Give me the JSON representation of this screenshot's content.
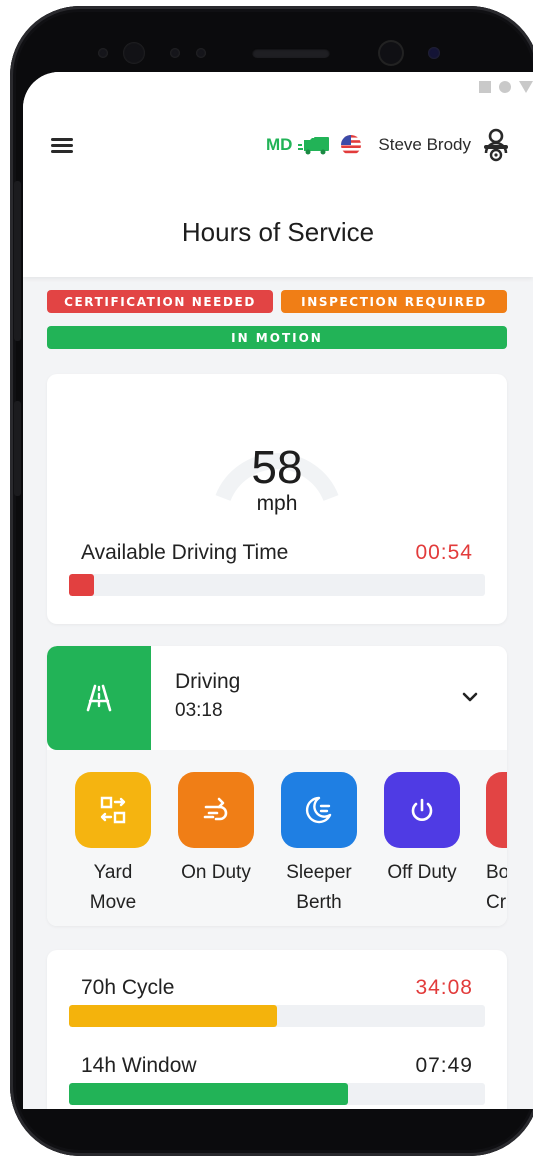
{
  "header": {
    "state_code": "MD",
    "driver_name": "Steve Brody",
    "title": "Hours of Service"
  },
  "badges": {
    "certification": "CERTIFICATION NEEDED",
    "inspection": "INSPECTION REQUIRED",
    "motion": "IN MOTION"
  },
  "speed": {
    "value": "58",
    "unit": "mph"
  },
  "available_driving": {
    "label": "Available Driving Time",
    "value": "00:54",
    "progress": 0.06
  },
  "duty_status": {
    "current": "Driving",
    "elapsed": "03:18",
    "options": [
      {
        "label": "Yard\nMove",
        "icon": "yard-move-icon",
        "color": "#f5b410"
      },
      {
        "label": "On Duty",
        "icon": "on-duty-icon",
        "color": "#f07e16"
      },
      {
        "label": "Sleeper\nBerth",
        "icon": "sleeper-berth-icon",
        "color": "#1f7fe3"
      },
      {
        "label": "Off Duty",
        "icon": "power-icon",
        "color": "#4f3be4"
      },
      {
        "label": "Bo\nCr",
        "icon": "border-crossing-icon",
        "color": "#e24444"
      }
    ]
  },
  "cycles": [
    {
      "label": "70h Cycle",
      "value": "34:08",
      "value_color": "#e23b3b",
      "bar_color": "#f4b30c",
      "progress": 0.5
    },
    {
      "label": "14h Window",
      "value": "07:49",
      "value_color": "#222222",
      "bar_color": "#22b357",
      "progress": 0.67
    }
  ],
  "colors": {
    "green": "#22b357",
    "red": "#e24444",
    "orange": "#f07e16"
  }
}
